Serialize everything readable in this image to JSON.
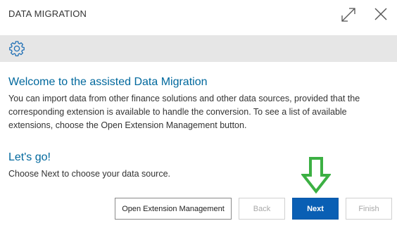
{
  "dialog": {
    "title": "DATA MIGRATION",
    "icons": {
      "expand": "expand-icon",
      "close": "close-icon",
      "settings": "gear-icon",
      "annotation": "down-arrow-icon"
    }
  },
  "content": {
    "welcome_heading": "Welcome to the assisted Data Migration",
    "welcome_text": "You can import data from other finance solutions and other data sources, provided that the corresponding extension is available to handle the conversion. To see a list of available extensions, choose the Open Extension Management button.",
    "lets_go_heading": "Let's go!",
    "lets_go_text": "Choose Next to choose your data source."
  },
  "buttons": {
    "open_extension_management": "Open Extension Management",
    "back": "Back",
    "next": "Next",
    "finish": "Finish"
  },
  "colors": {
    "accent_heading": "#00689d",
    "primary_button": "#0a5fb4",
    "toolbar_bg": "#e6e6e6",
    "annotation_arrow": "#3cb043"
  }
}
